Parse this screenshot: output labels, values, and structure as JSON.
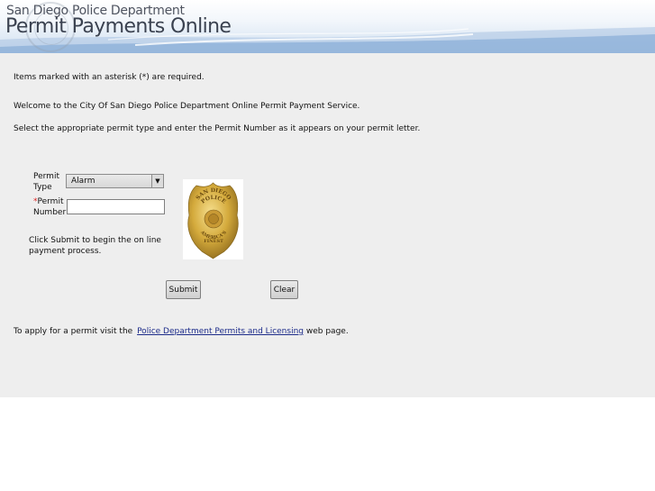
{
  "header": {
    "department": "San Diego Police Department",
    "app_title": "Permit Payments Online"
  },
  "intro": {
    "required_note": "Items marked with an asterisk (*) are required.",
    "welcome": "Welcome to the City Of San Diego Police Department Online Permit Payment Service.",
    "instructions": "Select the appropriate permit type and enter the Permit Number as it appears on your permit letter."
  },
  "form": {
    "permit_type_label": "Permit Type",
    "permit_type_value": "Alarm",
    "asterisk": "*",
    "permit_number_label": "Permit Number",
    "permit_number_value": "",
    "click_note": "Click Submit to begin the on line payment process.",
    "submit_label": "Submit",
    "clear_label": "Clear"
  },
  "badge": {
    "line1": "SAN DIEGO",
    "line2": "POLICE",
    "line3": "AMERICA'S",
    "line4": "FINEST"
  },
  "footer": {
    "prefix": "To apply for a permit visit the",
    "link_text": "Police Department Permits and Licensing",
    "suffix": "web page."
  },
  "colors": {
    "content_bg": "#eeeeee",
    "link": "#1d2c8a",
    "required_asterisk": "#dd2222",
    "badge_gold": "#d4aa3c"
  }
}
